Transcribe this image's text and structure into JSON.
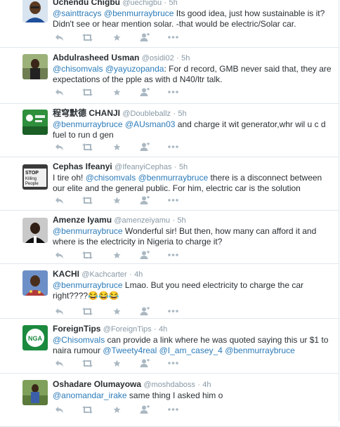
{
  "tweets": [
    {
      "fullname": "Uchendu Chigbu",
      "handle": "@uechigbu",
      "time": "5h",
      "text": [
        {
          "type": "mention",
          "text": "@sainttracys"
        },
        {
          "type": "text",
          "text": " "
        },
        {
          "type": "mention",
          "text": "@benmurraybruce"
        },
        {
          "type": "text",
          "text": " Its good idea, just how sustainable is it? Didn't see or hear mention solar. -that would be electric/Solar car."
        }
      ]
    },
    {
      "fullname": "Abdulrasheed Usman",
      "handle": "@osidi02",
      "time": "5h",
      "text": [
        {
          "type": "mention",
          "text": "@chisomvals"
        },
        {
          "type": "text",
          "text": " "
        },
        {
          "type": "mention",
          "text": "@yayuzopanda"
        },
        {
          "type": "text",
          "text": ": For d record, GMB never said that, they are expectations of the pple as with d N40/ltr talk."
        }
      ]
    },
    {
      "fullname": "程穹默德 CHANJI",
      "handle": "@Doubleballz",
      "time": "5h",
      "text": [
        {
          "type": "mention",
          "text": "@benmurraybruce"
        },
        {
          "type": "text",
          "text": " "
        },
        {
          "type": "mention",
          "text": "@AUsman03"
        },
        {
          "type": "text",
          "text": " and charge it wit generator,whr wil u c d fuel to run d gen"
        }
      ]
    },
    {
      "fullname": "Cephas Ifeanyi",
      "handle": "@IfeanyiCephas",
      "time": "5h",
      "text": [
        {
          "type": "text",
          "text": "I tire oh! "
        },
        {
          "type": "mention",
          "text": "@chisomvals"
        },
        {
          "type": "text",
          "text": " "
        },
        {
          "type": "mention",
          "text": "@benmurraybruce"
        },
        {
          "type": "text",
          "text": " there is a disconnect between our elite and the general public. For him, electric car is the solution"
        }
      ]
    },
    {
      "fullname": "Amenze Iyamu",
      "handle": "@amenzeiyamu",
      "time": "5h",
      "text": [
        {
          "type": "mention",
          "text": "@benmurraybruce"
        },
        {
          "type": "text",
          "text": " Wonderful sir! But then, how many can afford it and where is the electricity in Nigeria to charge it?"
        }
      ]
    },
    {
      "fullname": "KACHI",
      "handle": "@Kachcarter",
      "time": "4h",
      "text": [
        {
          "type": "mention",
          "text": "@benmurraybruce"
        },
        {
          "type": "text",
          "text": " Lmao. But you need electricity to charge the car right????😂😂😂"
        }
      ]
    },
    {
      "fullname": "ForeignTips",
      "handle": "@ForeignTips",
      "time": "4h",
      "text": [
        {
          "type": "mention",
          "text": "@Chisomvals"
        },
        {
          "type": "text",
          "text": " can provide a link where he was quoted saying this ur $1  to naira rumour "
        },
        {
          "type": "mention",
          "text": "@Tweety4real"
        },
        {
          "type": "text",
          "text": " "
        },
        {
          "type": "mention",
          "text": "@I_am_casey_4"
        },
        {
          "type": "text",
          "text": " "
        },
        {
          "type": "mention",
          "text": "@benmurraybruce"
        }
      ]
    },
    {
      "fullname": "Oshadare Olumayowa",
      "handle": "@moshdaboss",
      "time": "4h",
      "text": [
        {
          "type": "mention",
          "text": "@anomandar_irake"
        },
        {
          "type": "text",
          "text": " same thing I asked him o"
        }
      ]
    }
  ],
  "avatar_badges": {
    "cephas": "STOP Killing People",
    "foreigntips": "NGA"
  },
  "dot": "·",
  "colors": {
    "mention": "#2b7bb9",
    "muted": "#8899a6",
    "icon": "#aab8c2",
    "border": "#e1e8ed"
  },
  "icons": [
    "reply-icon",
    "retweet-icon",
    "favorite-icon",
    "follow-icon",
    "more-icon"
  ]
}
